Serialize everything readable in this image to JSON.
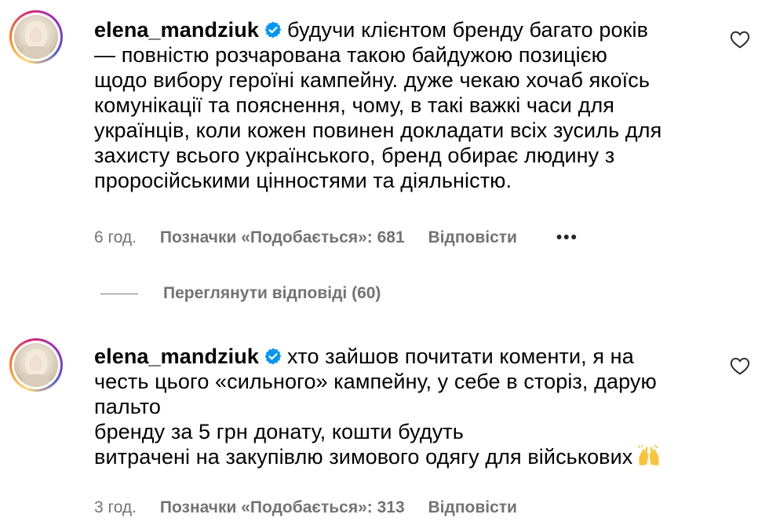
{
  "comments": [
    {
      "username": "elena_mandziuk",
      "verified_icon": "verified-badge-icon",
      "lines": [
        "будучи клієнтом бренду багато років",
        "— повністю розчарована такою байдужою позицією",
        "щодо вибору героїні кампейну. дуже чекаю хочаб якоїсь",
        "комунікації та пояснення, чому, в такі важкі часи для",
        "українців, коли кожен повинен докладати всіх зусиль для",
        "захисту всього українського, бренд обирає людину з",
        "проросійськими цінностями та діяльністю."
      ],
      "time": "6 год.",
      "likes": "Позначки «Подобається»: 681",
      "reply": "Відповісти",
      "more": "•••"
    },
    {
      "username": "elena_mandziuk",
      "verified_icon": "verified-badge-icon",
      "lines": [
        "хто зайшов почитати коменти, я на",
        "честь цього «сильного» кампейну, у себе в сторіз, дарую",
        "пальто",
        "бренду за 5 грн донату, кошти будуть",
        "витрачені на закупівлю зимового одягу для військових"
      ],
      "emoji": "raising-hands-emoji",
      "time": "3 год.",
      "likes": "Позначки «Подобається»: 313",
      "reply": "Відповісти"
    }
  ],
  "view_replies": "Переглянути відповіді (60)",
  "colors": {
    "text": "#000000",
    "meta": "#737373",
    "verified": "#0095f6"
  }
}
